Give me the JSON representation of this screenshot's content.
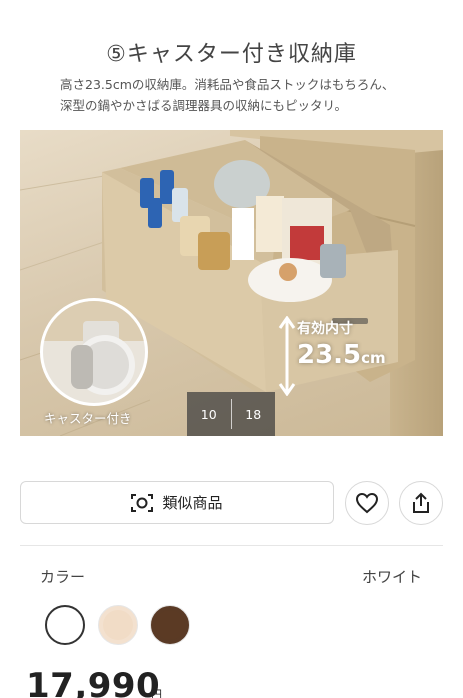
{
  "hero": {
    "title": "⑤キャスター付き収納庫",
    "description_line1": "高さ23.5cmの収納庫。消耗品や食品ストックはもちろん、",
    "description_line2": "深型の鍋やかさばる調理器具の収納にもピッタリ。",
    "caster_label": "キャスター付き",
    "dimension_line1": "有効内寸",
    "dimension_value": "23.5",
    "dimension_unit": "cm"
  },
  "pager": {
    "current": "10",
    "total": "18"
  },
  "actions": {
    "similar_label": "類似商品",
    "similar_icon": "camera-search-icon",
    "favorite_icon": "heart-icon",
    "share_icon": "share-icon"
  },
  "color": {
    "label": "カラー",
    "selected": "ホワイト",
    "swatches": [
      "#ffffff",
      "#f1dcc6",
      "#5b3a24"
    ]
  },
  "price": {
    "amount": "17,990",
    "unit": "円"
  }
}
